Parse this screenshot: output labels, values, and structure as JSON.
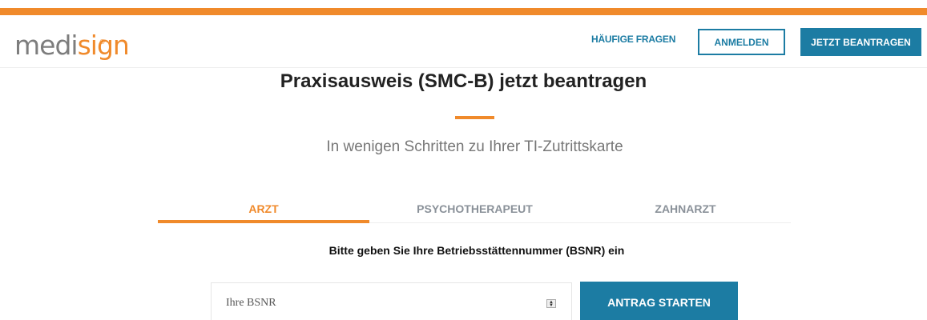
{
  "colors": {
    "accent": "#f08a2b",
    "primary": "#1c7ca3",
    "muted": "#8a9199"
  },
  "header": {
    "logo": {
      "part1": "medi",
      "part2": "sign",
      "registered": "®"
    },
    "faq_link": "HÄUFIGE FRAGEN",
    "login_button": "ANMELDEN",
    "apply_button": "JETZT BEANTRAGEN"
  },
  "main": {
    "title": "Praxisausweis (SMC-B) jetzt beantragen",
    "subtitle": "In wenigen Schritten zu Ihrer TI-Zutrittskarte",
    "tabs": [
      {
        "label": "ARZT",
        "active": true
      },
      {
        "label": "PSYCHOTHERAPEUT",
        "active": false
      },
      {
        "label": "ZAHNARZT",
        "active": false
      }
    ],
    "instruction": "Bitte geben Sie Ihre Betriebsstättennummer (BSNR) ein",
    "bsnr_input": {
      "placeholder": "Ihre BSNR",
      "value": ""
    },
    "spinner_icon": "number-spinner-icon",
    "start_button": "ANTRAG STARTEN"
  }
}
